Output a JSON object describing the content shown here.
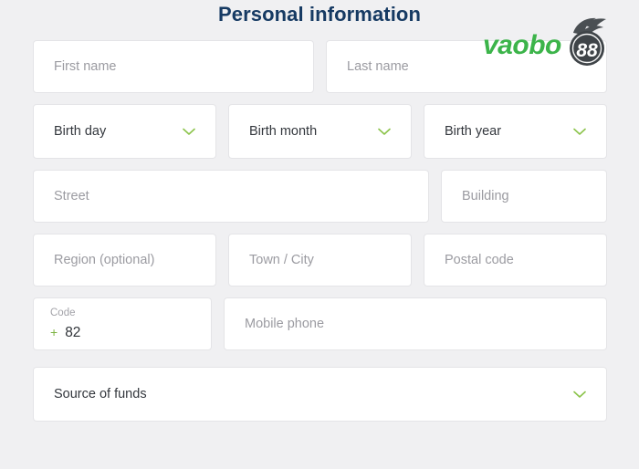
{
  "header": {
    "title": "Personal information"
  },
  "logo": {
    "name": "vaobo88-logo",
    "wordmark": "vaobo",
    "badge": "88",
    "wordmark_color": "#3cb44a",
    "badge_color": "#3f4448",
    "badge_text_color": "#ffffff"
  },
  "theme": {
    "page_background": "#f0f0f2",
    "field_background": "#ffffff",
    "field_border": "#e4e4e7",
    "title_color": "#163a63",
    "placeholder_color": "#9b9ba1",
    "value_color": "#33373d",
    "accent_green": "#7cb342"
  },
  "form": {
    "rows": [
      {
        "fields": [
          {
            "name": "first-name-input",
            "type": "text",
            "placeholder": "First name",
            "value": ""
          },
          {
            "name": "last-name-input",
            "type": "text",
            "placeholder": "Last name",
            "value": ""
          }
        ]
      },
      {
        "fields": [
          {
            "name": "birth-day-select",
            "type": "select",
            "label": "Birth day",
            "value": "Birth day",
            "icon": "chevron-down-icon"
          },
          {
            "name": "birth-month-select",
            "type": "select",
            "label": "Birth month",
            "value": "Birth month",
            "icon": "chevron-down-icon"
          },
          {
            "name": "birth-year-select",
            "type": "select",
            "label": "Birth year",
            "value": "Birth year",
            "icon": "chevron-down-icon"
          }
        ]
      },
      {
        "fields": [
          {
            "name": "street-input",
            "type": "text",
            "placeholder": "Street",
            "value": ""
          },
          {
            "name": "building-input",
            "type": "text",
            "placeholder": "Building",
            "value": ""
          }
        ]
      },
      {
        "fields": [
          {
            "name": "region-input",
            "type": "text",
            "placeholder": "Region (optional)",
            "value": ""
          },
          {
            "name": "town-city-input",
            "type": "text",
            "placeholder": "Town / City",
            "value": ""
          },
          {
            "name": "postal-code-input",
            "type": "text",
            "placeholder": "Postal code",
            "value": ""
          }
        ]
      },
      {
        "fields": [
          {
            "name": "country-code-field",
            "type": "code",
            "label": "Code",
            "prefix": "+",
            "value": "82"
          },
          {
            "name": "mobile-phone-input",
            "type": "text",
            "placeholder": "Mobile phone",
            "value": ""
          }
        ]
      },
      {
        "fields": [
          {
            "name": "source-of-funds-select",
            "type": "select",
            "label": "Source of funds",
            "value": "Source of funds",
            "icon": "chevron-down-icon"
          }
        ]
      }
    ]
  },
  "fields": {
    "first_name": {
      "placeholder": "First name"
    },
    "last_name": {
      "placeholder": "Last name"
    },
    "birth_day": {
      "value": "Birth day"
    },
    "birth_month": {
      "value": "Birth month"
    },
    "birth_year": {
      "value": "Birth year"
    },
    "street": {
      "placeholder": "Street"
    },
    "building": {
      "placeholder": "Building"
    },
    "region": {
      "placeholder": "Region (optional)"
    },
    "town_city": {
      "placeholder": "Town / City"
    },
    "postal_code": {
      "placeholder": "Postal code"
    },
    "code": {
      "label": "Code",
      "prefix": "+",
      "value": "82"
    },
    "mobile_phone": {
      "placeholder": "Mobile phone"
    },
    "source_of_funds": {
      "value": "Source of funds"
    }
  }
}
